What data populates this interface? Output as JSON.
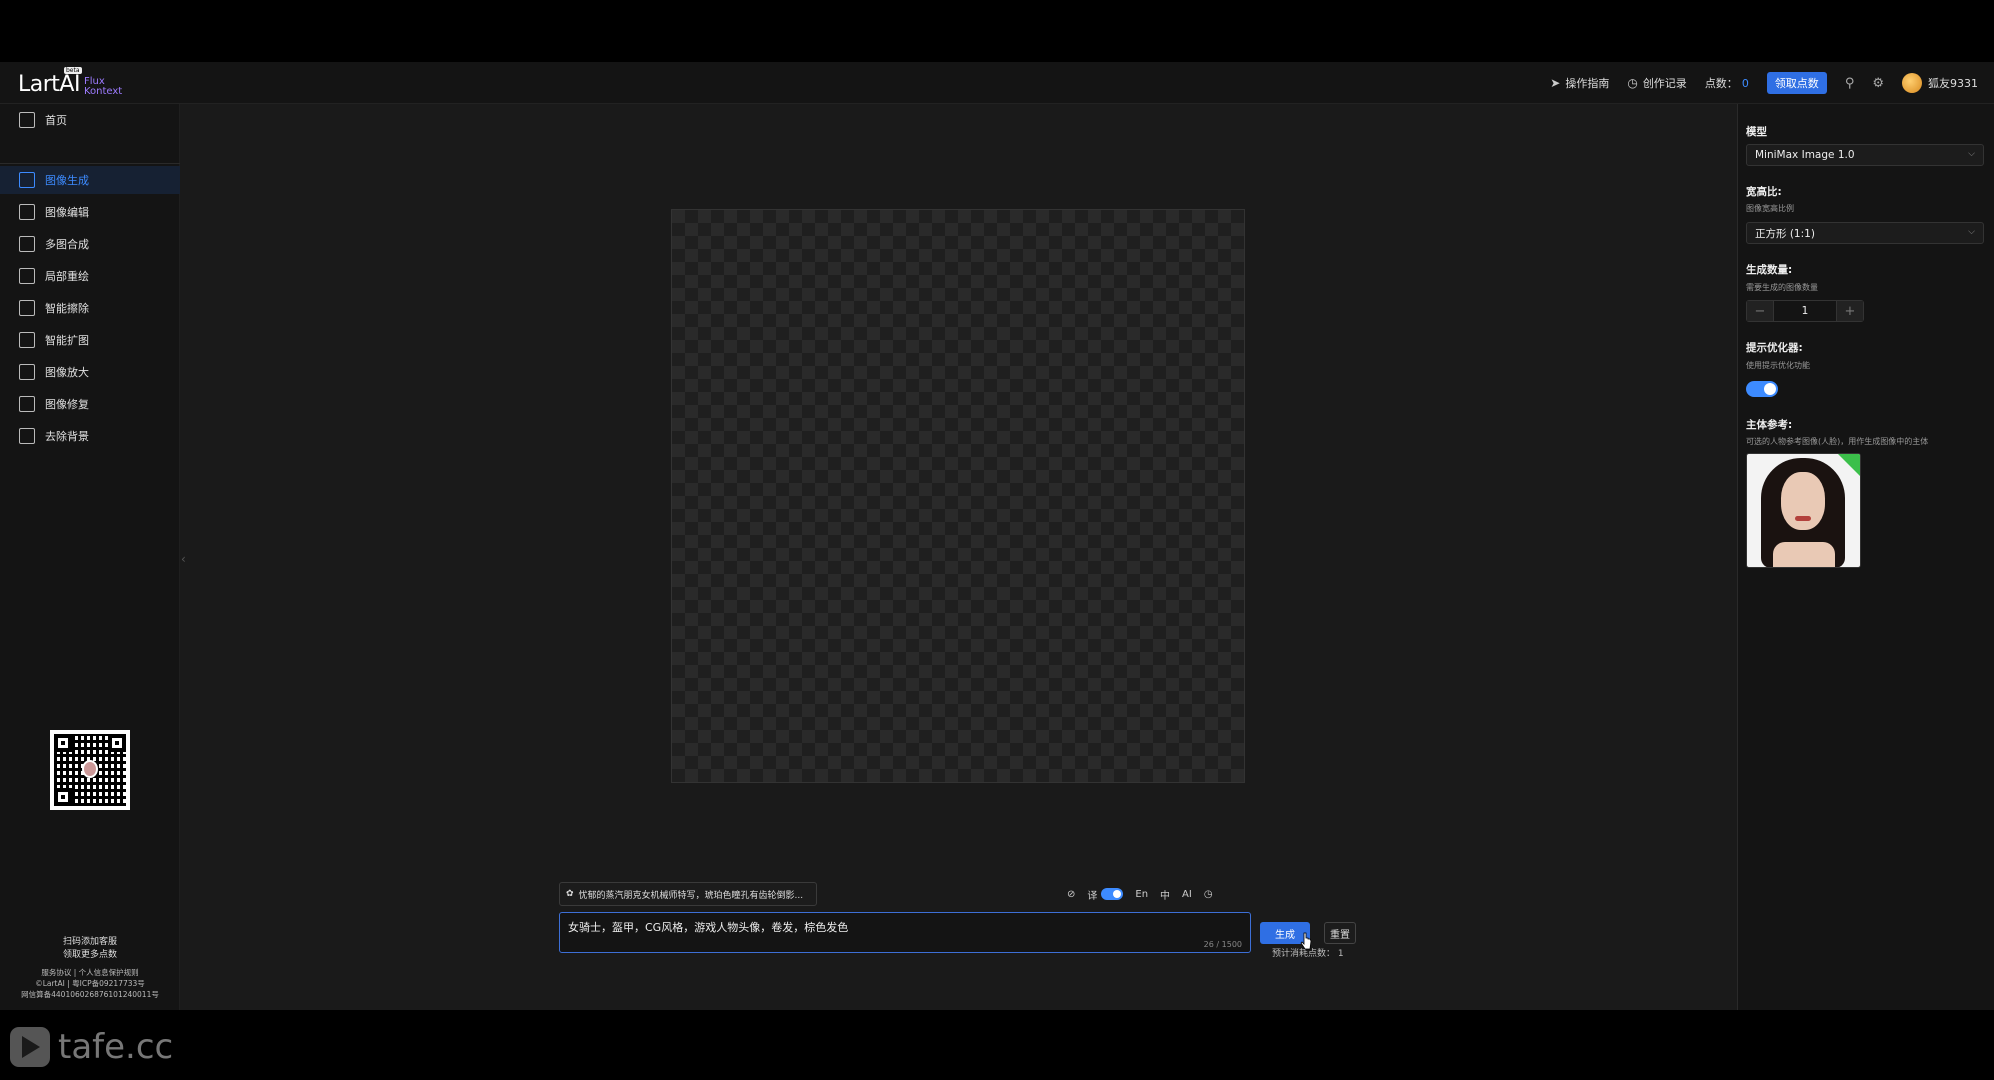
{
  "header": {
    "logo_main": "LartAI",
    "logo_beta": "beta",
    "logo_sub1": "Flux",
    "logo_sub2": "Kontext",
    "guide": "操作指南",
    "history": "创作记录",
    "points_label": "点数：",
    "points_value": "0",
    "claim": "领取点数",
    "username": "狐友9331",
    "accent_color": "#2f6fe4"
  },
  "sidebar": {
    "items": [
      {
        "label": "首页",
        "icon": "home-icon"
      },
      {
        "label": "图像生成",
        "icon": "chat-icon"
      },
      {
        "label": "图像编辑",
        "icon": "image-icon"
      },
      {
        "label": "多图合成",
        "icon": "layers-icon"
      },
      {
        "label": "局部重绘",
        "icon": "edit-icon"
      },
      {
        "label": "智能擦除",
        "icon": "eraser-icon"
      },
      {
        "label": "智能扩图",
        "icon": "crop-icon"
      },
      {
        "label": "图像放大",
        "icon": "upscale-icon"
      },
      {
        "label": "图像修复",
        "icon": "repair-icon"
      },
      {
        "label": "去除背景",
        "icon": "file-icon"
      }
    ],
    "qr_line1": "扫码添加客服",
    "qr_line2": "领取更多点数",
    "footer1": "服务协议 | 个人信息保护规则",
    "footer2": "©LartAI | 粤ICP备09217733号",
    "footer3": "网信算备440106026876101240011号"
  },
  "prompt": {
    "suggestion": "忧郁的蒸汽朋克女机械师特写，琥珀色瞳孔有齿轮倒影...",
    "translate_label": "译",
    "lang_en": "En",
    "lang_zh": "中",
    "ai_label": "AI",
    "text": "女骑士，盔甲，CG风格，游戏人物头像，卷发，棕色发色",
    "count": "26 / 1500",
    "generate": "生成",
    "reset": "重置",
    "estimate": "预计消耗点数：  1"
  },
  "right_panel": {
    "model_label": "模型",
    "model_value": "MiniMax Image 1.0",
    "ratio_label": "宽高比:",
    "ratio_hint": "图像宽高比例",
    "ratio_value": "正方形 (1:1)",
    "count_label": "生成数量:",
    "count_hint": "需要生成的图像数量",
    "count_value": "1",
    "optimizer_label": "提示优化器:",
    "optimizer_hint": "使用提示优化功能",
    "optimizer_on": true,
    "subject_label": "主体参考:",
    "subject_hint": "可选的人物参考图像(人脸)，用作生成图像中的主体"
  },
  "watermark": "tafe.cc"
}
